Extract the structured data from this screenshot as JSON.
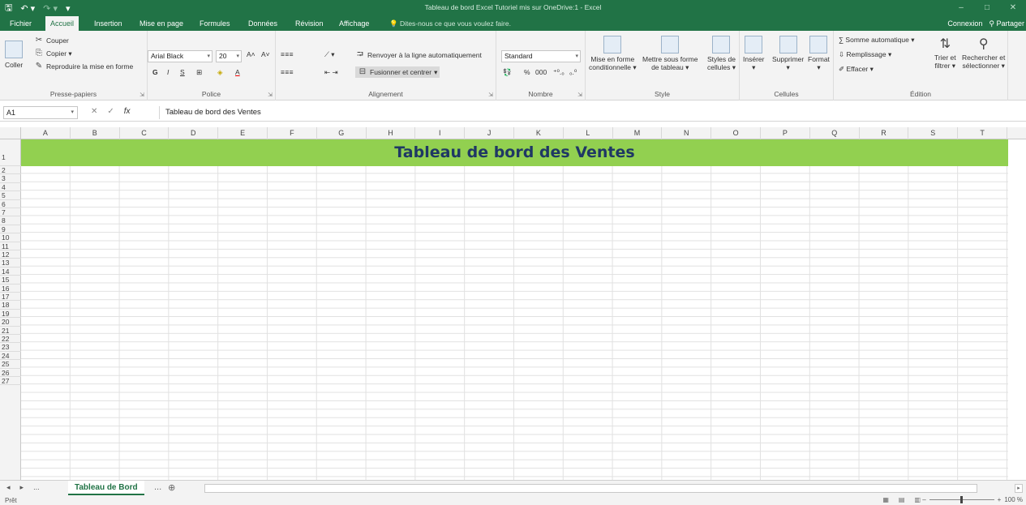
{
  "window": {
    "title": "Tableau de bord Excel Tutoriel mis sur OneDrive:1 - Excel",
    "qa_save": "🖫",
    "qa_undo": "↶ ▾",
    "qa_redo": "↷ ▾",
    "qa_more": "▾",
    "btn_min": "–",
    "btn_restore": "□",
    "btn_close": "✕"
  },
  "ribbon_tabs": {
    "fichier": "Fichier",
    "accueil": "Accueil",
    "insertion": "Insertion",
    "mise_en_page": "Mise en page",
    "formules": "Formules",
    "donnees": "Données",
    "revision": "Révision",
    "affichage": "Affichage",
    "tell_me": "💡 Dites-nous ce que vous voulez faire.",
    "connexion": "Connexion",
    "partager": "⚲ Partager"
  },
  "clipboard": {
    "coller": "Coller",
    "couper": "Couper",
    "copier": "Copier ▾",
    "reproduire": "Reproduire la mise en forme",
    "label": "Presse-papiers"
  },
  "font": {
    "name": "Arial Black",
    "size": "20",
    "grow": "A˄",
    "shrink": "A˅",
    "bold": "G",
    "italic": "I",
    "underline": "S",
    "borders": "⊞",
    "fill": "◈",
    "color": "A",
    "label": "Police"
  },
  "alignment": {
    "wrap": "Renvoyer à la ligne automatiquement",
    "merge": "Fusionner et centrer",
    "label": "Alignement"
  },
  "number": {
    "format": "Standard",
    "currency": "💱",
    "percent": "%",
    "thousands": "000",
    "inc_dec": "⁺⁰.₀",
    "dec_dec": "₀.⁰",
    "label": "Nombre"
  },
  "styles": {
    "conditional_1": "Mise en forme",
    "conditional_2": "conditionnelle ▾",
    "table_1": "Mettre sous forme",
    "table_2": "de tableau ▾",
    "cell_styles_1": "Styles de",
    "cell_styles_2": "cellules ▾",
    "label": "Style"
  },
  "cells": {
    "inserer": "Insérer",
    "supprimer": "Supprimer",
    "format": "Format",
    "label": "Cellules"
  },
  "editing": {
    "autosum": "∑ Somme automatique ▾",
    "fill": "⇩ Remplissage ▾",
    "clear": "✐ Effacer ▾",
    "sort_1": "Trier et",
    "sort_2": "filtrer ▾",
    "find_1": "Rechercher et",
    "find_2": "sélectionner ▾",
    "label": "Édition"
  },
  "formula_bar": {
    "name_box": "A1",
    "cancel": "✕",
    "enter": "✓",
    "fx": "fx",
    "content": "Tableau de bord des Ventes"
  },
  "columns": [
    "A",
    "B",
    "C",
    "D",
    "E",
    "F",
    "G",
    "H",
    "I",
    "J",
    "K",
    "L",
    "M",
    "N",
    "O",
    "P",
    "Q",
    "R",
    "S",
    "T"
  ],
  "rows": [
    "1",
    "2",
    "3",
    "4",
    "5",
    "6",
    "7",
    "8",
    "9",
    "10",
    "11",
    "12",
    "13",
    "14",
    "15",
    "16",
    "17",
    "18",
    "19",
    "20",
    "21",
    "22",
    "23",
    "24",
    "25",
    "26",
    "27"
  ],
  "sheet": {
    "banner_text": "Tableau de bord des Ventes",
    "banner_color": "#92d050",
    "banner_text_color": "#1f3864"
  },
  "sheet_tabs": {
    "nav_prev": "◂",
    "nav_next": "▸",
    "ellipsis_left": "...",
    "active": "Tableau de Bord",
    "ellipsis_right": "...",
    "add": "⊕"
  },
  "status": {
    "ready": "Prêt",
    "zoom": "100 %"
  },
  "colors": {
    "accent": "#217346"
  }
}
